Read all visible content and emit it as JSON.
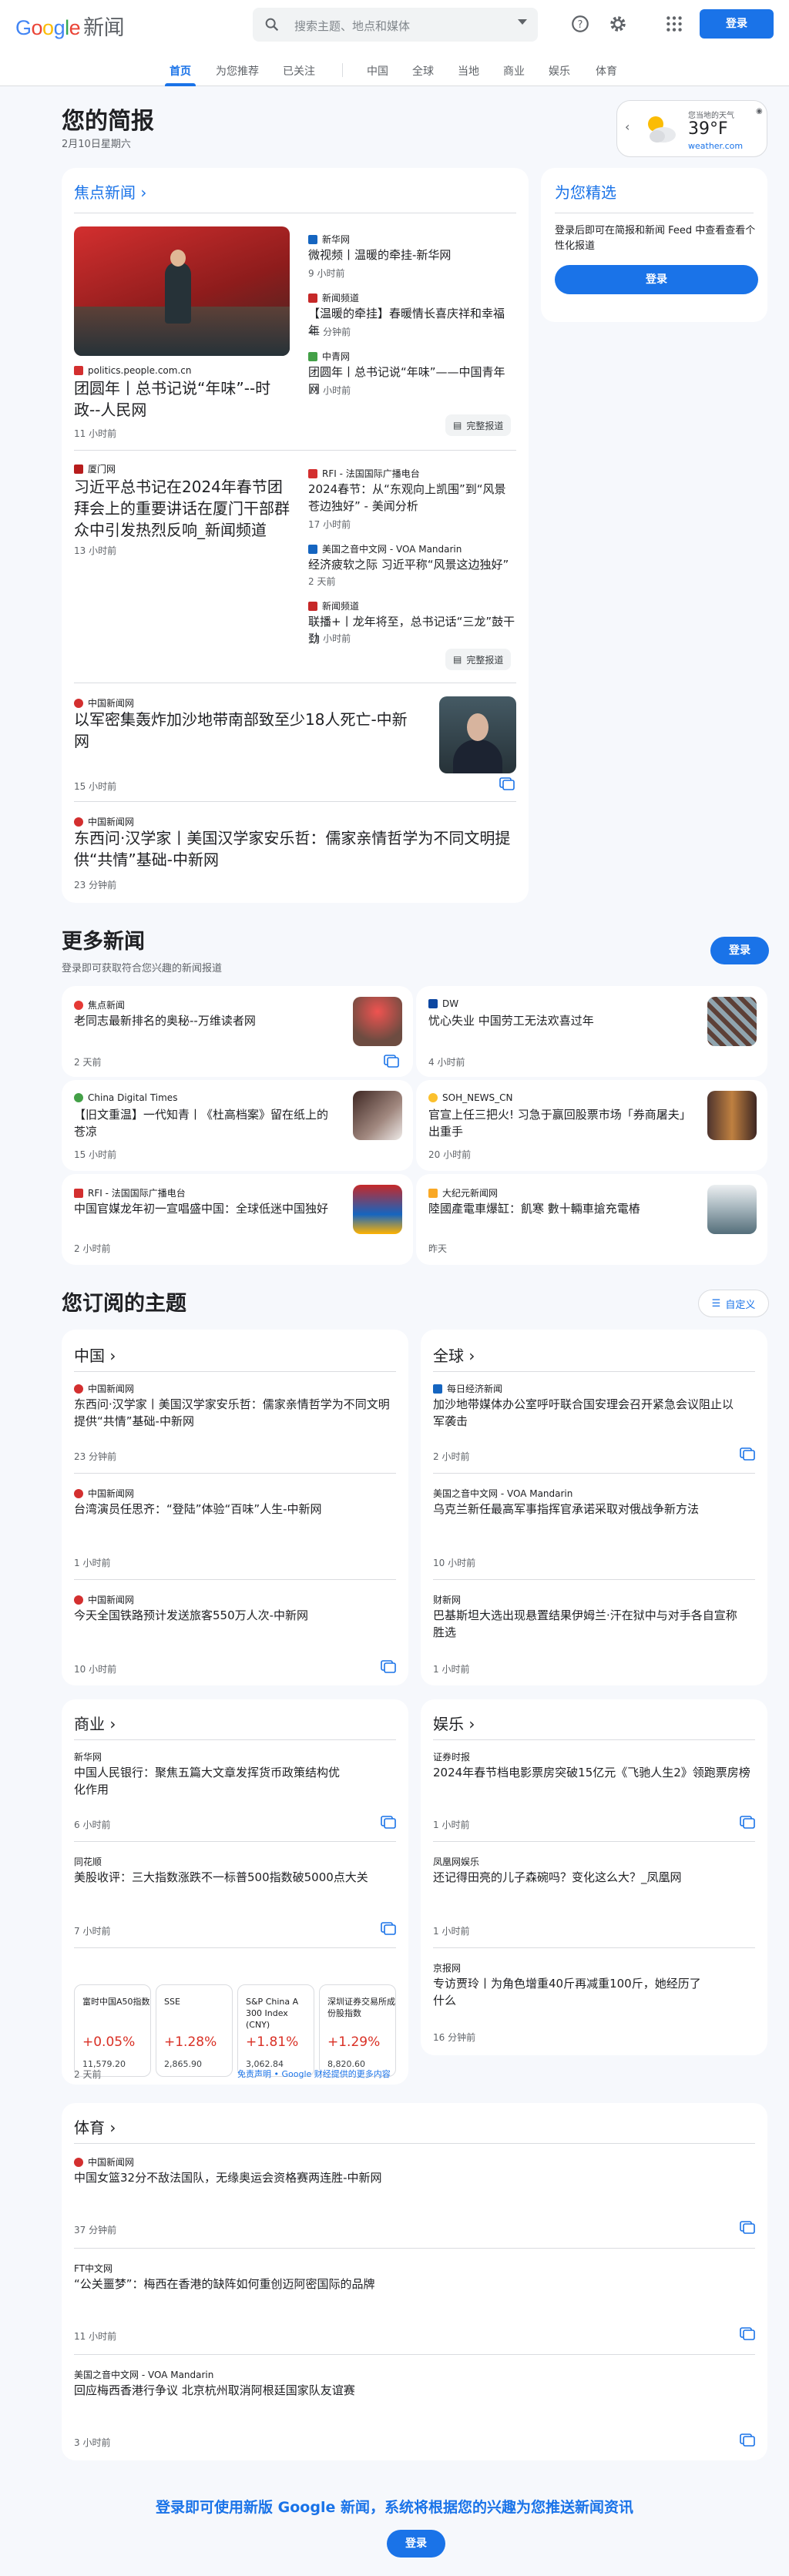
{
  "header": {
    "logo_google": "Google",
    "logo_news": "新闻",
    "search_placeholder": "搜索主题、地点和媒体",
    "login": "登录"
  },
  "nav": [
    "首页",
    "为您推荐",
    "已关注",
    "中国",
    "全球",
    "当地",
    "商业",
    "娱乐",
    "体育"
  ],
  "brief": {
    "title": "您的简报",
    "date": "2月10日星期六"
  },
  "weather": {
    "label": "您当地的天气",
    "temp": "39°F",
    "source": "weather.com"
  },
  "foryou": {
    "title": "为您精选",
    "text": "登录后即可在简报和新闻 Feed 中查看查看个性化报道",
    "button": "登录"
  },
  "top": {
    "section": "焦点新闻",
    "full_coverage": "完整报道",
    "g1": {
      "src": "politics.people.com.cn",
      "title": "团圆年丨总书记说“年味”--时政--人民网",
      "time": "11 小时前",
      "related": [
        {
          "src": "新华网",
          "title": "微视频丨温暖的牵挂-新华网",
          "time": "9 小时前"
        },
        {
          "src": "新闻频道",
          "title": "【温暖的牵挂】春暖情长喜庆祥和幸福年",
          "time": "41 分钟前"
        },
        {
          "src": "中青网",
          "title": "团圆年丨总书记说“年味”——中国青年网",
          "time": "11 小时前"
        }
      ]
    },
    "g2": {
      "src": "厦门网",
      "title": "习近平总书记在2024年春节团拜会上的重要讲话在厦门干部群众中引发热烈反响_新闻频道",
      "time": "13 小时前",
      "related": [
        {
          "src": "RFI - 法国国际广播电台",
          "title": "2024春节：从“东观向上凯围”到“风景苍边独好” - 美闻分析",
          "time": "17 小时前"
        },
        {
          "src": "美国之音中文网 - VOA Mandarin",
          "title": "经济疲软之际 习近平称“风景这边独好”",
          "time": "2 天前"
        },
        {
          "src": "新闻频道",
          "title": "联播+丨龙年将至，总书记话“三龙”鼓干劲",
          "time": "11 小时前"
        }
      ]
    },
    "s3": {
      "src": "中国新闻网",
      "title": "以军密集轰炸加沙地带南部致至少18人死亡-中新网",
      "time": "15 小时前"
    },
    "s4": {
      "src": "中国新闻网",
      "title": "东西问·汉学家丨美国汉学家安乐哲：儒家亲情哲学为不同文明提供“共情”基础-中新网",
      "time": "23 分钟前"
    }
  },
  "more": {
    "title": "更多新闻",
    "subtitle": "登录即可获取符合您兴趣的新闻报道",
    "button": "登录",
    "items": [
      {
        "src": "焦点新闻",
        "title": "老同志最新排名的奥秘--万维读者网",
        "time": "2 天前"
      },
      {
        "src": "DW",
        "title": "忧心失业 中国劳工无法欢喜过年",
        "time": "4 小时前"
      },
      {
        "src": "China Digital Times",
        "title": "【旧文重温】一代知青丨《杜高档案》留在纸上的苍凉",
        "time": "15 小时前"
      },
      {
        "src": "SOH_NEWS_CN",
        "title": "官宣上任三把火! 习急于赢回股票市场「券商屠夫」出重手",
        "time": "20 小时前"
      },
      {
        "src": "RFI - 法国国际广播电台",
        "title": "中国官媒龙年初一宣唱盛中国：全球低迷中国独好",
        "time": "2 小时前"
      },
      {
        "src": "大纪元新闻网",
        "title": "陸國產電車爆缸：飢寒 數十輛車搶充電樁",
        "time": "昨天"
      }
    ]
  },
  "topics": {
    "title": "您订阅的主题",
    "customize": "自定义",
    "china": {
      "name": "中国",
      "items": [
        {
          "src": "中国新闻网",
          "title": "东西问·汉学家丨美国汉学家安乐哲：儒家亲情哲学为不同文明提供“共情”基础-中新网",
          "time": "23 分钟前"
        },
        {
          "src": "中国新闻网",
          "title": "台湾演员任思齐：“登陆”体验“百味”人生-中新网",
          "time": "1 小时前"
        },
        {
          "src": "中国新闻网",
          "title": "今天全国铁路预计发送旅客550万人次-中新网",
          "time": "10 小时前"
        }
      ]
    },
    "world": {
      "name": "全球",
      "items": [
        {
          "src": "每日经济新闻",
          "title": "加沙地带媒体办公室呼吁联合国安理会召开紧急会议阻止以军袭击",
          "time": "2 小时前"
        },
        {
          "src": "美国之音中文网 - VOA Mandarin",
          "title": "乌克兰新任最高军事指挥官承诺采取对俄战争新方法",
          "time": "10 小时前"
        },
        {
          "src": "财新网",
          "title": "巴基斯坦大选出现悬置结果伊姆兰·汗在狱中与对手各自宣称胜选",
          "time": "1 小时前"
        }
      ]
    },
    "business": {
      "name": "商业",
      "items": [
        {
          "src": "新华网",
          "title": "中国人民银行：聚焦五篇大文章发挥货币政策结构优化作用",
          "time": "6 小时前"
        },
        {
          "src": "同花顺",
          "title": "美股收评：三大指数涨跌不一标普500指数破5000点大关",
          "time": "7 小时前"
        }
      ],
      "stocks": [
        {
          "name": "富时中国A50指数",
          "pct": "+0.05%",
          "val": "11,579.20"
        },
        {
          "name": "SSE",
          "pct": "+1.28%",
          "val": "2,865.90"
        },
        {
          "name": "S&P China A 300 Index (CNY)",
          "pct": "+1.81%",
          "val": "3,062.84"
        },
        {
          "name": "深圳证券交易所成份股指数",
          "pct": "+1.29%",
          "val": "8,820.60"
        }
      ],
      "stocks_time": "2 天前",
      "disclaimer": "免责声明 • Google 财经提供的更多内容"
    },
    "ent": {
      "name": "娱乐",
      "items": [
        {
          "src": "证券时报",
          "title": "2024年春节档电影票房突破15亿元《飞驰人生2》领跑票房榜",
          "time": "1 小时前"
        },
        {
          "src": "凤凰网娱乐",
          "title": "还记得田亮的儿子森碗吗？变化这么大？_凤凰网",
          "time": "1 小时前"
        },
        {
          "src": "京报网",
          "title": "专访贾玲丨为角色增重40斤再减重100斤，她经历了什么",
          "time": "16 分钟前"
        }
      ]
    },
    "sports": {
      "name": "体育",
      "items": [
        {
          "src": "中国新闻网",
          "title": "中国女篮32分不敌法国队，无缘奥运会资格赛两连胜-中新网",
          "time": "37 分钟前"
        },
        {
          "src": "FT中文网",
          "title": "“公关噩梦”：梅西在香港的缺阵如何重创迈阿密国际的品牌",
          "time": "11 小时前"
        },
        {
          "src": "美国之音中文网 - VOA Mandarin",
          "title": "回应梅西香港行争议 北京杭州取消阿根廷国家队友谊赛",
          "time": "3 小时前"
        }
      ]
    }
  },
  "footer": {
    "text": "登录即可使用新版 Google 新闻，系统将根据您的兴趣为您推送新闻资讯",
    "button": "登录"
  }
}
